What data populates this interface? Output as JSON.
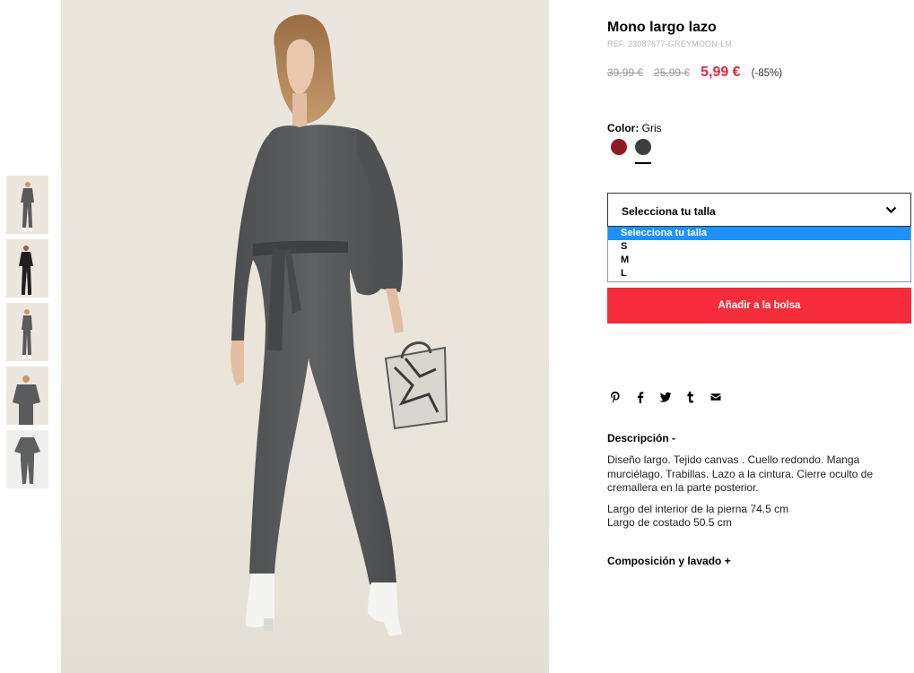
{
  "product": {
    "title": "Mono largo lazo",
    "ref": "REF. 33087677-GREYMOON-LM",
    "original_price": "39,99 €",
    "previous_price": "25,99 €",
    "sale_price": "5,99 €",
    "discount": "(-85%)"
  },
  "color": {
    "label": "Color:",
    "value": "Gris",
    "swatches": [
      {
        "name": "burgundy",
        "hex": "#8e1a24",
        "selected": false
      },
      {
        "name": "grey",
        "hex": "#3d3e40",
        "selected": true
      }
    ]
  },
  "size_select": {
    "label": "Selecciona tu talla",
    "options": [
      "Selecciona tu talla",
      "S",
      "M",
      "L"
    ],
    "highlighted_index": 0
  },
  "add_button_label": "Añadir a la bolsa",
  "share_icons": [
    "pinterest-icon",
    "facebook-icon",
    "twitter-icon",
    "tumblr-icon",
    "email-icon"
  ],
  "description": {
    "title": "Descripción -",
    "text": "Diseño largo. Tejido canvas . Cuello redondo. Manga murciélago. Trabillas. Lazo a la cintura. Cierre oculto de cremallera en la parte posterior.",
    "measure_1": "Largo del interior de la pierna 74.5 cm",
    "measure_2": "Largo de costado 50.5 cm"
  },
  "composition_title": "Composición y lavado +",
  "colors": {
    "accent_red": "#f42c3b",
    "sale_red": "#e3283b",
    "dropdown_highlight": "#1e90ff"
  },
  "thumbnails": [
    "thumb-grey-front",
    "thumb-black-front",
    "thumb-grey-side",
    "thumb-grey-detail",
    "thumb-grey-flat"
  ]
}
